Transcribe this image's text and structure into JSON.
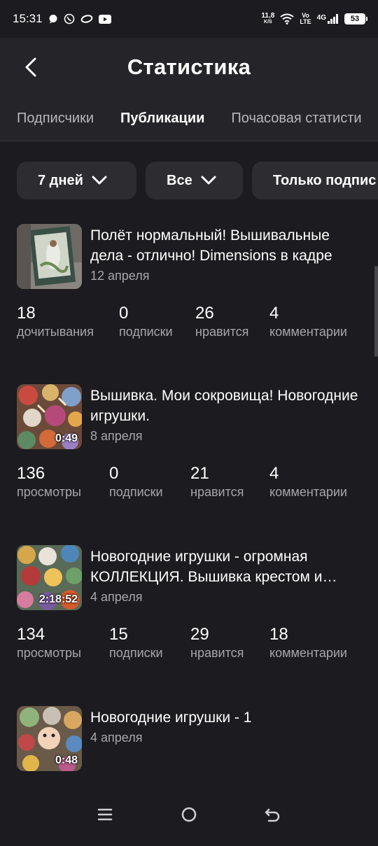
{
  "status_bar": {
    "time": "15:31",
    "net_speed_value": "11,8",
    "net_speed_unit": "K/S",
    "volte_top": "Vo",
    "volte_bottom": "LTE",
    "network": "4G",
    "battery": "53"
  },
  "header": {
    "title": "Статистика"
  },
  "tabs": [
    {
      "label": "Подписчики"
    },
    {
      "label": "Публикации",
      "active": true
    },
    {
      "label": "Почасовая статисти"
    }
  ],
  "filters": [
    {
      "label": "7 дней"
    },
    {
      "label": "Все"
    },
    {
      "label": "Только подпис"
    }
  ],
  "posts": [
    {
      "title": "Полёт нормальный! Вышивальные дела - отлично! Dimensions в кадре",
      "date": "12 апреля",
      "duration": "",
      "stats": [
        {
          "value": "18",
          "label": "дочитывания"
        },
        {
          "value": "0",
          "label": "подписки"
        },
        {
          "value": "26",
          "label": "нравится"
        },
        {
          "value": "4",
          "label": "комментарии"
        }
      ]
    },
    {
      "title": "Вышивка. Мои сокровища! Новогодние игрушки.",
      "date": "8 апреля",
      "duration": "0:49",
      "stats": [
        {
          "value": "136",
          "label": "просмотры"
        },
        {
          "value": "0",
          "label": "подписки"
        },
        {
          "value": "21",
          "label": "нравится"
        },
        {
          "value": "4",
          "label": "комментарии"
        }
      ]
    },
    {
      "title": "Новогодние игрушки - огромная КОЛЛЕКЦИЯ. Вышивка крестом и…",
      "date": "4 апреля",
      "duration": "2:18:52",
      "stats": [
        {
          "value": "134",
          "label": "просмотры"
        },
        {
          "value": "15",
          "label": "подписки"
        },
        {
          "value": "29",
          "label": "нравится"
        },
        {
          "value": "18",
          "label": "комментарии"
        }
      ]
    },
    {
      "title": "Новогодние игрушки - 1",
      "date": "4 апреля",
      "duration": "0:48",
      "stats": []
    }
  ],
  "colors": {
    "background": "#1c1b1f",
    "header": "#252428",
    "chip": "#2d2c31",
    "secondary_text": "#a7a6aa"
  }
}
